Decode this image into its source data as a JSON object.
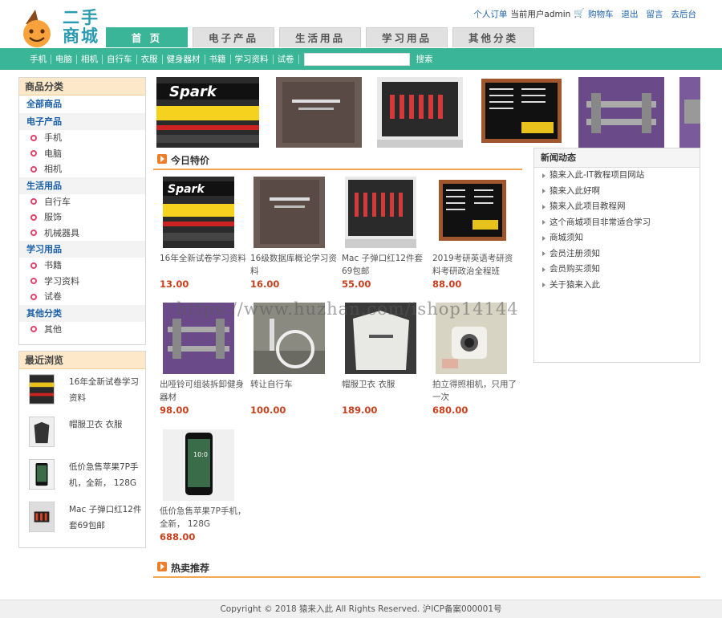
{
  "logo": {
    "text_line1": "二手",
    "text_line2": "商城"
  },
  "top_links": {
    "orders": "个人订单",
    "current_user": "当前用户admin",
    "cart": "购物车",
    "logout": "退出",
    "message": "留言",
    "admin": "去后台"
  },
  "main_tabs": [
    "首 页",
    "电子产品",
    "生活用品",
    "学习用品",
    "其他分类"
  ],
  "sub_nav": {
    "items": [
      "手机",
      "电脑",
      "相机",
      "自行车",
      "衣服",
      "健身器材",
      "书籍",
      "学习资料",
      "试卷"
    ],
    "search_value": "",
    "search_label": "搜索"
  },
  "categories": {
    "title": "商品分类",
    "all": "全部商品",
    "groups": [
      {
        "name": "电子产品",
        "items": [
          "手机",
          "电脑",
          "相机"
        ]
      },
      {
        "name": "生活用品",
        "items": [
          "自行车",
          "服饰",
          "机械器具"
        ]
      },
      {
        "name": "学习用品",
        "items": [
          "书籍",
          "学习资料",
          "试卷"
        ]
      },
      {
        "name": "其他分类",
        "items": [
          "其他"
        ]
      }
    ]
  },
  "recent": {
    "title": "最近浏览",
    "items": [
      "16年全新试卷学习资料",
      "帽服卫衣 衣服",
      "低价急售苹果7P手机，全新， 128G",
      "Mac 子弹口红12件套69包邮"
    ]
  },
  "special": {
    "title": "今日特价",
    "products": [
      {
        "name": "16年全新试卷学习资料",
        "price": "13.00"
      },
      {
        "name": "16级数据库概论学习资料",
        "price": "16.00"
      },
      {
        "name": "Mac 子弹口红12件套69包邮",
        "price": "55.00"
      },
      {
        "name": "2019考研英语考研资料考研政治全程班",
        "price": "88.00"
      },
      {
        "name": "出哑铃可组装拆卸健身器材",
        "price": "98.00"
      },
      {
        "name": "转让自行车",
        "price": "100.00"
      },
      {
        "name": "帽服卫衣 衣服",
        "price": "189.00"
      },
      {
        "name": "拍立得照相机，只用了一次",
        "price": "680.00"
      },
      {
        "name": "低价急售苹果7P手机，全新， 128G",
        "price": "688.00"
      }
    ]
  },
  "hot": {
    "title": "热卖推荐"
  },
  "news": {
    "title": "新闻动态",
    "items": [
      "猿来入此-IT教程项目网站",
      "猿来入此好啊",
      "猿来入此项目教程网",
      "这个商城项目非常适合学习",
      "商城须知",
      "会员注册须知",
      "会员购买须知",
      "关于猿来入此"
    ]
  },
  "watermark": "https://www.huzhan.com/ishop14144",
  "footer": "Copyright © 2018 猿来入此 All Rights Reserved. 沪ICP备案000001号",
  "colors": {
    "brand": "#3bb597",
    "price": "#c8401e",
    "link": "#1a5fa8",
    "accent": "#f2a64f"
  }
}
